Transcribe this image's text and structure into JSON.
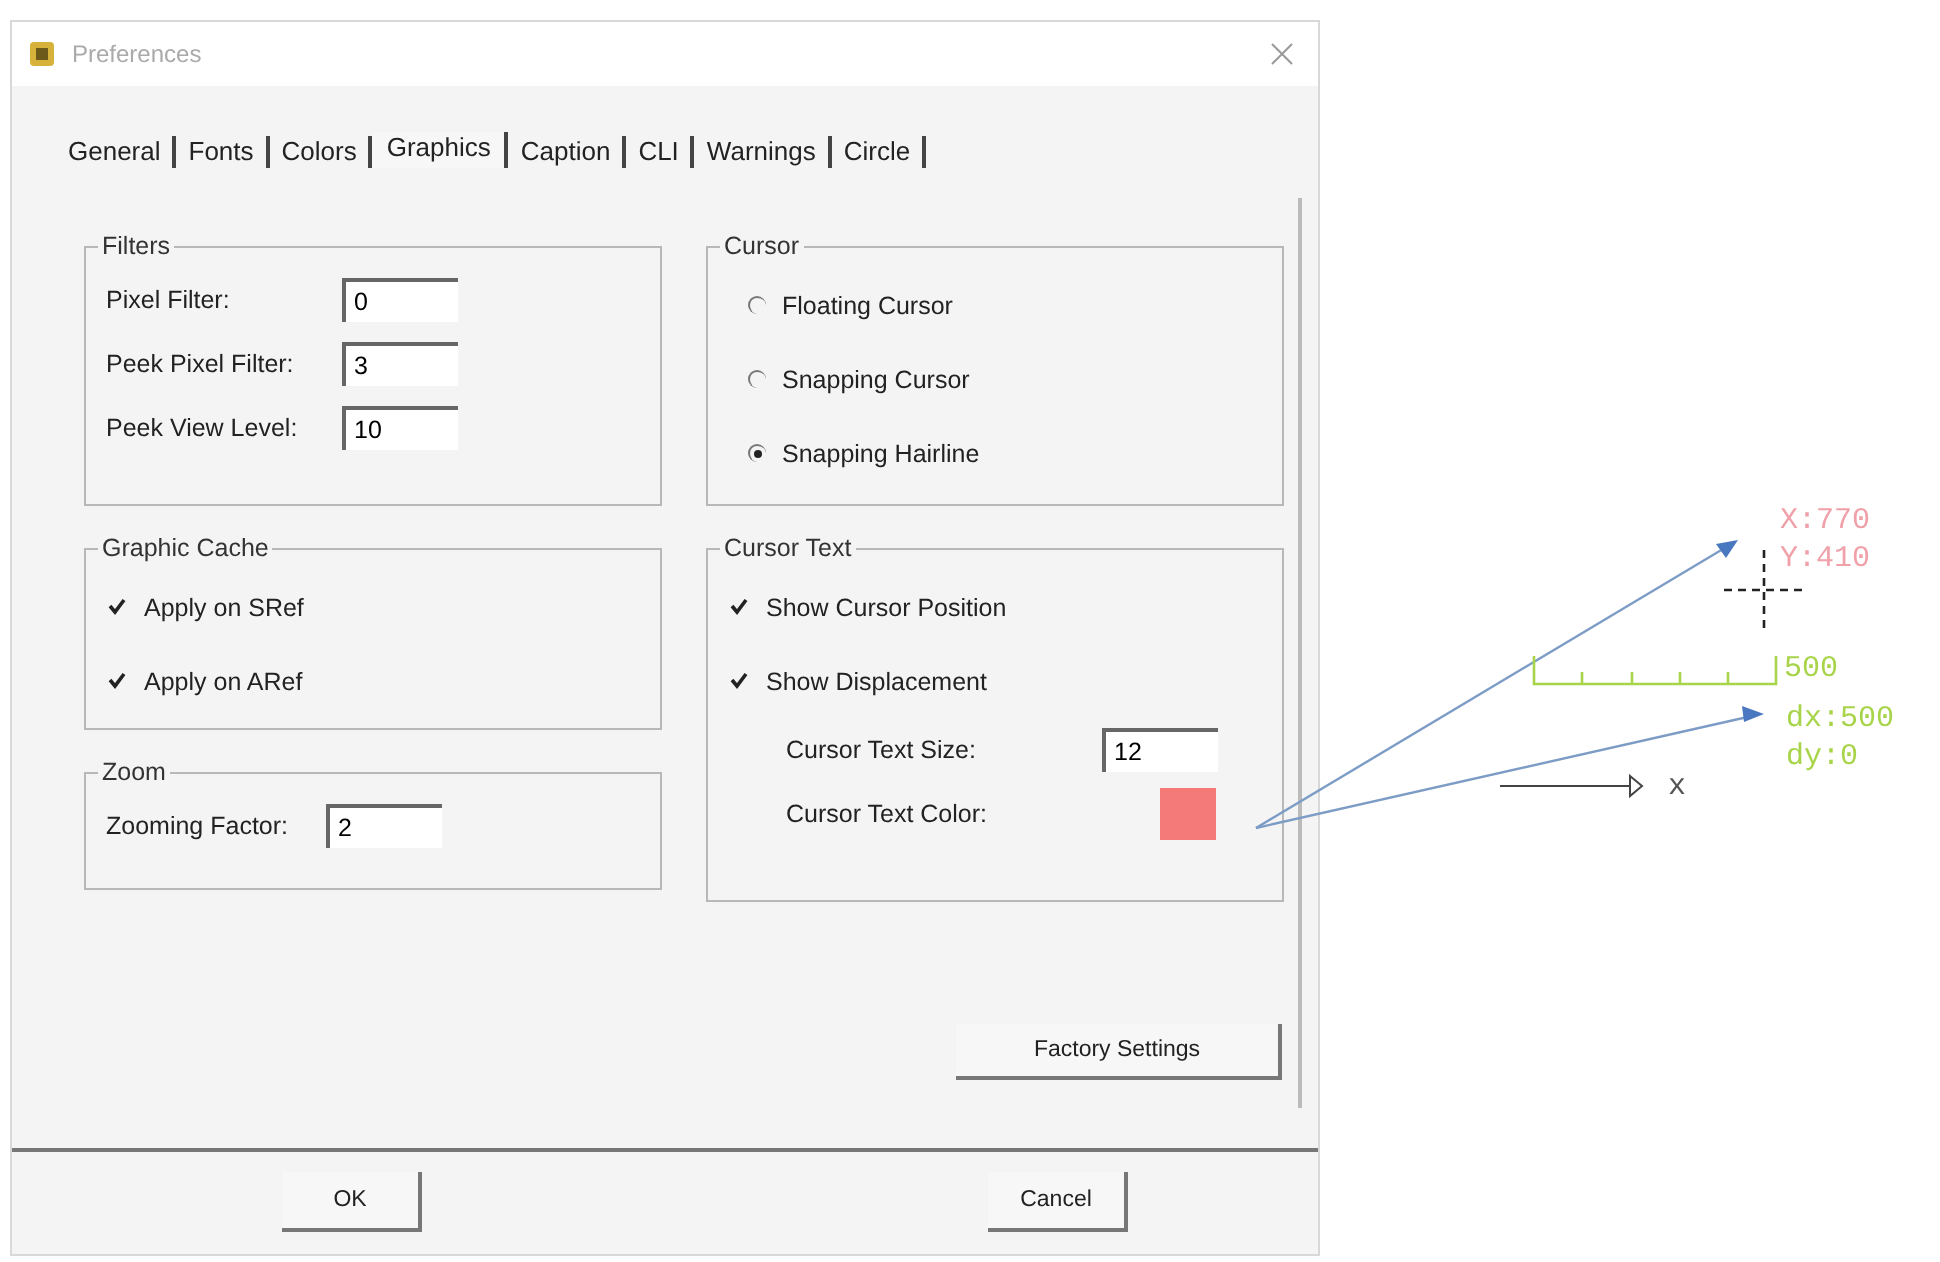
{
  "window": {
    "title": "Preferences"
  },
  "tabs": [
    {
      "label": "General",
      "selected": false
    },
    {
      "label": "Fonts",
      "selected": false
    },
    {
      "label": "Colors",
      "selected": false
    },
    {
      "label": "Graphics",
      "selected": true
    },
    {
      "label": "Caption",
      "selected": false
    },
    {
      "label": "CLI",
      "selected": false
    },
    {
      "label": "Warnings",
      "selected": false
    },
    {
      "label": "Circle",
      "selected": false
    }
  ],
  "filters": {
    "title": "Filters",
    "fields": [
      {
        "label": "Pixel Filter:",
        "value": "0"
      },
      {
        "label": "Peek Pixel Filter:",
        "value": "3"
      },
      {
        "label": "Peek View Level:",
        "value": "10"
      }
    ]
  },
  "cursor": {
    "title": "Cursor",
    "options": [
      {
        "label": "Floating Cursor",
        "selected": false
      },
      {
        "label": "Snapping Cursor",
        "selected": false
      },
      {
        "label": "Snapping Hairline",
        "selected": true
      }
    ]
  },
  "graphic_cache": {
    "title": "Graphic Cache",
    "checks": [
      {
        "label": "Apply on SRef",
        "checked": true
      },
      {
        "label": "Apply on ARef",
        "checked": true
      }
    ]
  },
  "cursor_text": {
    "title": "Cursor Text",
    "checks": [
      {
        "label": "Show Cursor Position",
        "checked": true
      },
      {
        "label": "Show Displacement",
        "checked": true
      }
    ],
    "size_field": {
      "label": "Cursor Text Size:",
      "value": "12"
    },
    "color_field": {
      "label": "Cursor Text Color:",
      "color": "#f47a7a"
    }
  },
  "zoom": {
    "title": "Zoom",
    "field": {
      "label": "Zooming Factor:",
      "value": "2"
    }
  },
  "buttons": {
    "factory": "Factory Settings",
    "ok": "OK",
    "cancel": "Cancel"
  },
  "annotation": {
    "position": [
      "X:770",
      "Y:410"
    ],
    "scale_label": "500",
    "displacement": [
      "dx:500",
      "dy:0"
    ],
    "axis_label": "x"
  }
}
